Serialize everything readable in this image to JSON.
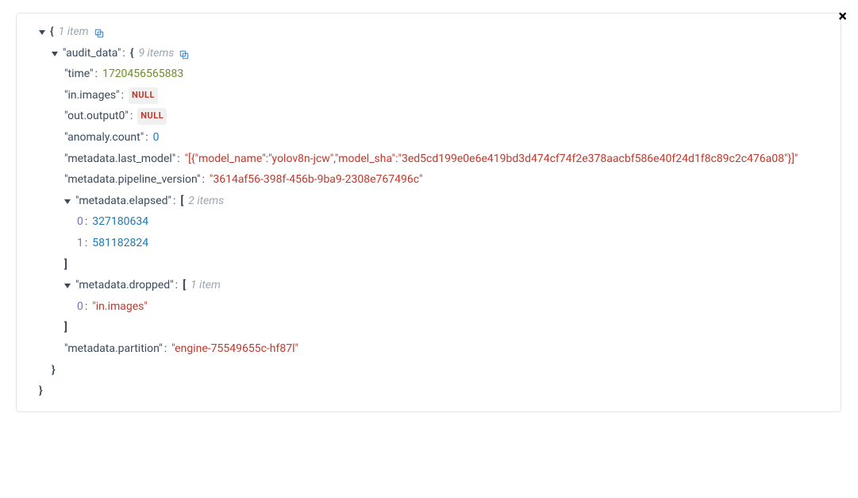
{
  "close_label": "×",
  "root": {
    "brace_open": "{",
    "brace_close": "}",
    "items_count": "1 item"
  },
  "audit_data": {
    "key": "audit_data",
    "brace_open": "{",
    "brace_close": "}",
    "items_count": "9 items",
    "entries": {
      "time": {
        "key": "time",
        "value": "1720456565883"
      },
      "in_images": {
        "key": "in.images",
        "value": "NULL"
      },
      "out_output0": {
        "key": "out.output0",
        "value": "NULL"
      },
      "anomaly_count": {
        "key": "anomaly.count",
        "value": "0"
      },
      "metadata_last_model": {
        "key": "metadata.last_model",
        "value": "[{\"model_name\":\"yolov8n-jcw\",\"model_sha\":\"3ed5cd199e0e6e419bd3d474cf74f2e378aacbf586e40f24d1f8c89c2c476a08\"}]"
      },
      "metadata_pipeline_version": {
        "key": "metadata.pipeline_version",
        "value": "3614af56-398f-456b-9ba9-2308e767496c"
      },
      "metadata_elapsed": {
        "key": "metadata.elapsed",
        "bracket_open": "[",
        "bracket_close": "]",
        "items_count": "2 items",
        "items": [
          {
            "index": "0",
            "value": "327180634"
          },
          {
            "index": "1",
            "value": "581182824"
          }
        ]
      },
      "metadata_dropped": {
        "key": "metadata.dropped",
        "bracket_open": "[",
        "bracket_close": "]",
        "items_count": "1 item",
        "items": [
          {
            "index": "0",
            "value": "in.images"
          }
        ]
      },
      "metadata_partition": {
        "key": "metadata.partition",
        "value": "engine-75549655c-hf87l"
      }
    }
  },
  "colon": ":"
}
